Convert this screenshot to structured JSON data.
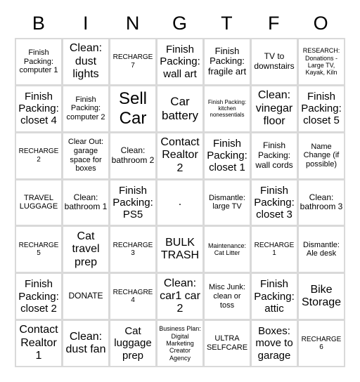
{
  "header": [
    "B",
    "I",
    "N",
    "G",
    "T",
    "F",
    "O"
  ],
  "cells": [
    [
      "Finish Packing: computer 1",
      "Clean: dust lights",
      "RECHARGE 7",
      "Finish Packing: wall art",
      "Finish Packing: fragile art",
      "TV to downstairs",
      "RESEARCH: Donations - Large TV, Kayak, Kiln"
    ],
    [
      "Finish Packing: closet 4",
      "Finish Packing: computer 2",
      "Sell Car",
      "Car battery",
      "Finish Packing: kitchen nonessentials",
      "Clean: vinegar floor",
      "Finish Packing: closet 5"
    ],
    [
      "RECHARGE 2",
      "Clear Out: garage space for boxes",
      "Clean: bathroom 2",
      "Contact Realtor 2",
      "Finish Packing: closet 1",
      "Finish Packing: wall cords",
      "Name Change (if possible)"
    ],
    [
      "TRAVEL LUGGAGE",
      "Clean: bathroom 1",
      "Finish Packing: PS5",
      ".",
      "Dismantle: large TV",
      "Finish Packing: closet 3",
      "Clean: bathroom 3"
    ],
    [
      "RECHARGE 5",
      "Cat travel prep",
      "RECHARGE 3",
      "BULK TRASH",
      "Maintenance: Cat Litter",
      "RECHARGE 1",
      "Dismantle: Ale desk"
    ],
    [
      "Finish Packing: closet 2",
      "DONATE",
      "RECHAGRE 4",
      "Clean: car1 car 2",
      "Misc Junk: clean or toss",
      "Finish Packing: attic",
      "Bike Storage"
    ],
    [
      "Contact Realtor 1",
      "Clean: dust fan",
      "Cat luggage prep",
      "Business Plan: Digital Marketing Creator Agency",
      "ULTRA SELFCARE",
      "Boxes: move to garage",
      "RECHARGE 6"
    ]
  ]
}
